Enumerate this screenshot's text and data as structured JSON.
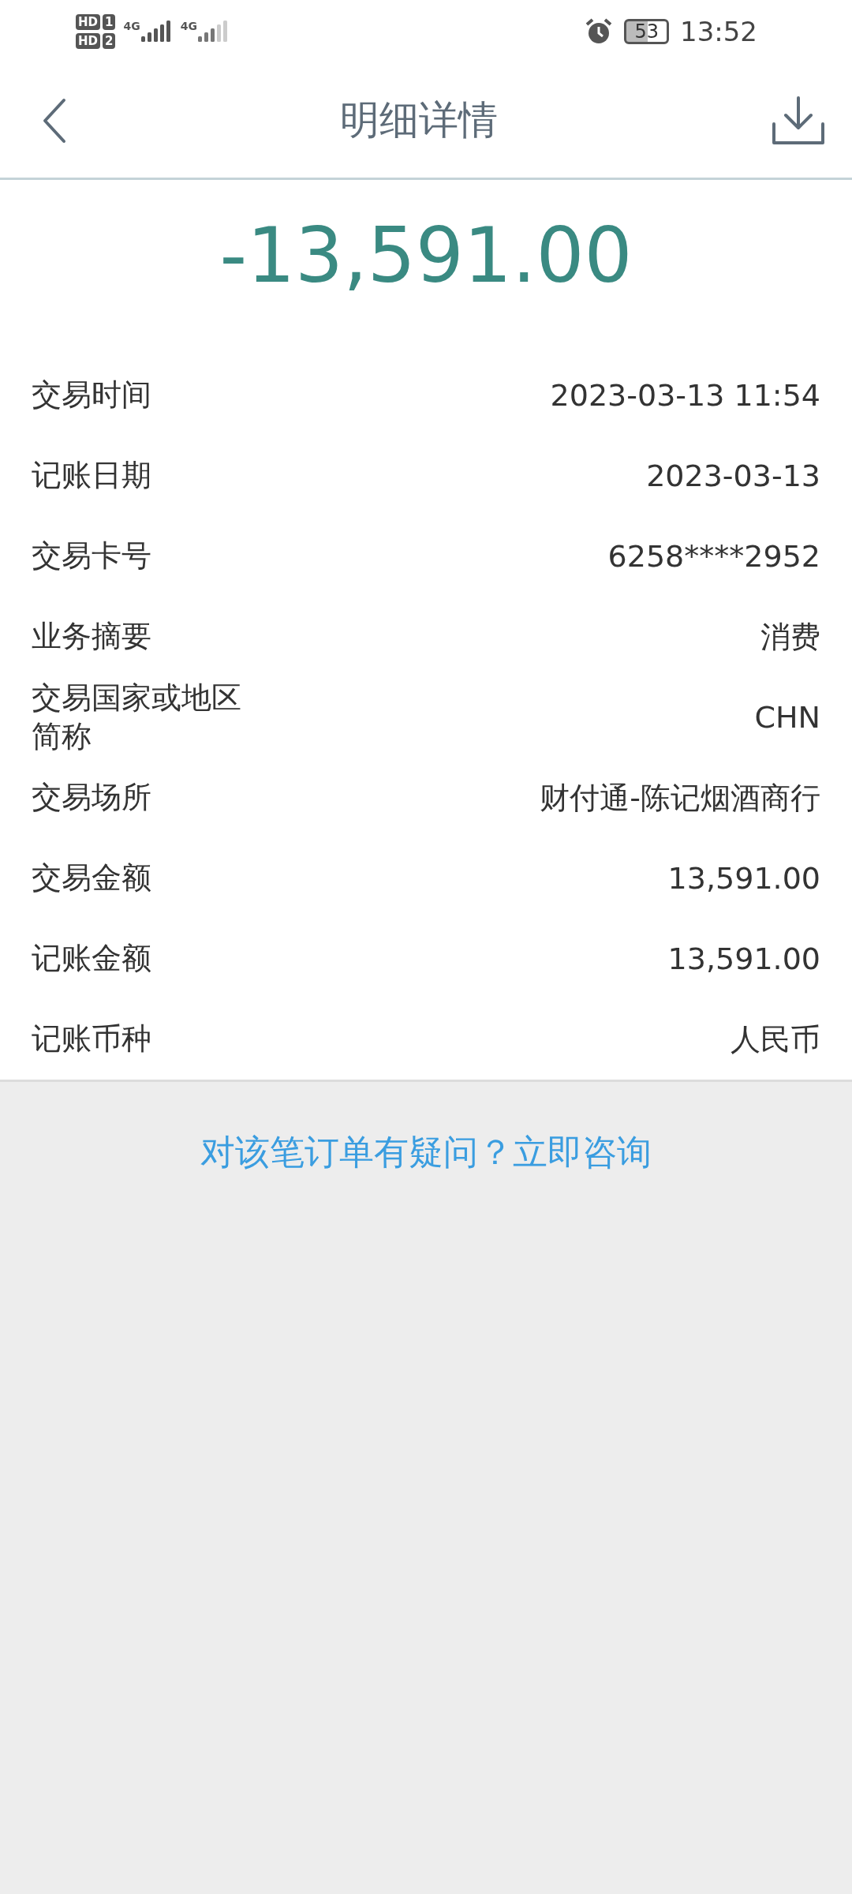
{
  "status_bar": {
    "sim_badges": [
      {
        "label": "HD",
        "slot": "1"
      },
      {
        "label": "HD",
        "slot": "2"
      }
    ],
    "networks": [
      {
        "label": "4G",
        "active": true
      },
      {
        "label": "4G",
        "active": false
      }
    ],
    "battery": "53",
    "time": "13:52"
  },
  "header": {
    "title": "明细详情"
  },
  "amount": "-13,591.00",
  "details": [
    {
      "label": "交易时间",
      "value": "2023-03-13 11:54"
    },
    {
      "label": "记账日期",
      "value": "2023-03-13"
    },
    {
      "label": "交易卡号",
      "value": "6258****2952"
    },
    {
      "label": "业务摘要",
      "value": "消费"
    },
    {
      "label": "交易国家或地区简称",
      "value": "CHN"
    },
    {
      "label": "交易场所",
      "value": "财付通-陈记烟酒商行"
    },
    {
      "label": "交易金额",
      "value": "13,591.00"
    },
    {
      "label": "记账金额",
      "value": "13,591.00"
    },
    {
      "label": "记账币种",
      "value": "人民币"
    }
  ],
  "inquiry_link": "对该笔订单有疑问？立即咨询"
}
